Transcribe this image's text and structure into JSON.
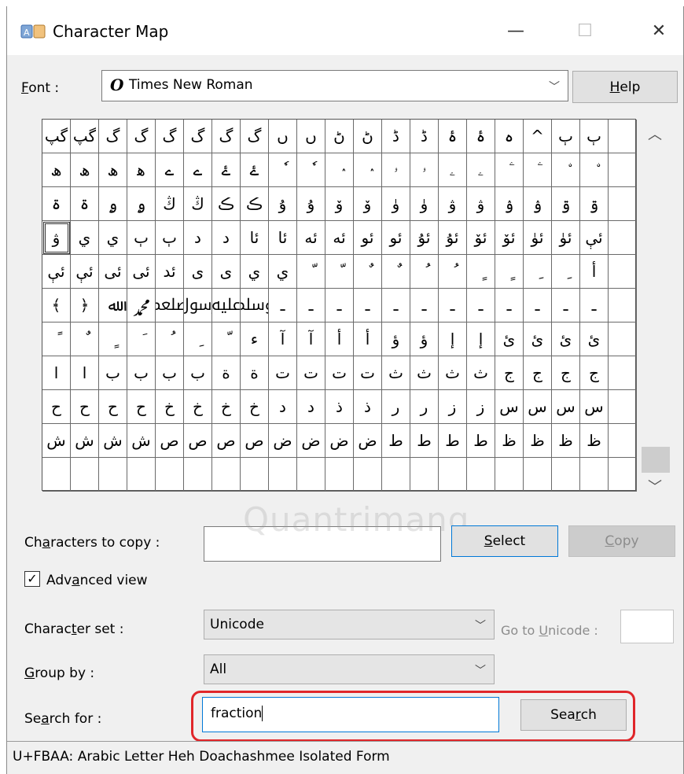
{
  "window": {
    "title": "Character Map",
    "minimize": "—",
    "maximize": "☐",
    "close": "✕"
  },
  "font": {
    "label_pre": "",
    "label_key": "F",
    "label_post": "ont :",
    "value": "Times New Roman",
    "icon_glyph": "O",
    "help_pre": "",
    "help_key": "H",
    "help_post": "elp"
  },
  "grid": {
    "rows": [
      [
        "گپ",
        "گپ",
        "گ",
        "گ",
        "گ",
        "گ",
        "گ",
        "گ",
        "ں",
        "ں",
        "ڻ",
        "ڻ",
        "ڈ",
        "ڈ",
        "ۂ",
        "ۂ",
        "ہ",
        "^",
        "ٻ",
        "ٻ",
        " "
      ],
      [
        "ھ",
        "ھ",
        "ھ",
        "ﮬ",
        "ے",
        "ے",
        "ۓ",
        "ۓ",
        "ٗ",
        "ٗ",
        "ٛ",
        "ٛ",
        "ۥ",
        "ۥ",
        "ۦ",
        "ۦ",
        "ۧ",
        "ۧ",
        "ۨ",
        "ۨ",
        " "
      ],
      [
        "ۃ",
        "ۃ",
        "ۄ",
        "ۄ",
        "ڭ",
        "ڭ",
        "ڪ",
        "ڪ",
        "ۇ",
        "ۇ",
        "ۆ",
        "ۆ",
        "ۈ",
        "ۈ",
        "ۋ",
        "ۋ",
        "ۉ",
        "ۉ",
        "ۊ",
        "ۊ",
        " "
      ],
      [
        "ۋ",
        "ي",
        "ي",
        "ٻ",
        "ٻ",
        "د",
        "د",
        "ئا",
        "ئا",
        "ئە",
        "ئە",
        "ئو",
        "ئو",
        "ئۇ",
        "ئۇ",
        "ئۆ",
        "ئۆ",
        "ئۈ",
        "ئۈ",
        "ئې",
        " "
      ],
      [
        "ئې",
        "ئې",
        "ئى",
        "ئى",
        "ئد",
        "ى",
        "ى",
        "ي",
        "ي",
        "ّ",
        "ّ",
        "ٌ",
        "ٌ",
        "ُ",
        "ُ",
        "ٍ",
        "ٍ",
        "ِ",
        "ِ",
        "أ",
        " "
      ],
      [
        "﴾",
        "﴿",
        "ﷲ",
        "ﷴ",
        "ﷵ",
        "ﷶ",
        "ﷷ",
        "ﷸ",
        "ـ",
        "ـ",
        "ـ",
        "ـ",
        "ـ",
        "ـ",
        "ـ",
        "ـ",
        "ـ",
        "ـ",
        "ـ",
        "ـ",
        " "
      ],
      [
        "ً",
        "ٌ",
        "ٍ",
        "َ",
        "ُ",
        "ِ",
        "ّ",
        "ء",
        "آ",
        "آ",
        "أ",
        "أ",
        "ؤ",
        "ؤ",
        "إ",
        "إ",
        "ئ",
        "ئ",
        "ئ",
        "ئ",
        " "
      ],
      [
        "ا",
        "ا",
        "ب",
        "ب",
        "ب",
        "ب",
        "ة",
        "ة",
        "ت",
        "ت",
        "ت",
        "ت",
        "ث",
        "ث",
        "ث",
        "ث",
        "ج",
        "ج",
        "ج",
        "ج",
        " "
      ],
      [
        "ح",
        "ح",
        "ح",
        "ح",
        "خ",
        "خ",
        "خ",
        "خ",
        "د",
        "د",
        "ذ",
        "ذ",
        "ر",
        "ر",
        "ز",
        "ز",
        "س",
        "س",
        "س",
        "س",
        " "
      ],
      [
        "ش",
        "ش",
        "ش",
        "ش",
        "ص",
        "ص",
        "ص",
        "ص",
        "ض",
        "ض",
        "ض",
        "ض",
        "ط",
        "ط",
        "ط",
        "ط",
        "ظ",
        "ظ",
        "ظ",
        "ظ",
        " "
      ],
      [
        " ",
        " ",
        " ",
        " ",
        " ",
        " ",
        " ",
        " ",
        " ",
        " ",
        " ",
        " ",
        " ",
        " ",
        " ",
        " ",
        " ",
        " ",
        " ",
        " ",
        " "
      ]
    ]
  },
  "copy": {
    "label_pre": "Ch",
    "label_key": "a",
    "label_post": "racters to copy :",
    "value": "",
    "select_pre": "",
    "select_key": "S",
    "select_post": "elect",
    "copy_pre": "",
    "copy_key": "C",
    "copy_post": "opy"
  },
  "watermark": "Quantrimang",
  "advanced": {
    "label_pre": "Adv",
    "label_key": "a",
    "label_post": "nced view",
    "checked": "✓"
  },
  "charset": {
    "label_pre": "Charac",
    "label_key": "t",
    "label_post": "er set :",
    "value": "Unicode",
    "goto_pre": "Go to ",
    "goto_key": "U",
    "goto_post": "nicode :"
  },
  "group": {
    "label_pre": "",
    "label_key": "G",
    "label_post": "roup by :",
    "value": "All"
  },
  "search": {
    "label_pre": "Se",
    "label_key": "a",
    "label_post": "rch for :",
    "value": "fraction",
    "button_pre": "Sea",
    "button_key": "r",
    "button_post": "ch"
  },
  "status": "U+FBAA: Arabic Letter Heh Doachashmee Isolated Form",
  "colors": {
    "highlight": "#e0262a",
    "focus": "#0078d7"
  }
}
